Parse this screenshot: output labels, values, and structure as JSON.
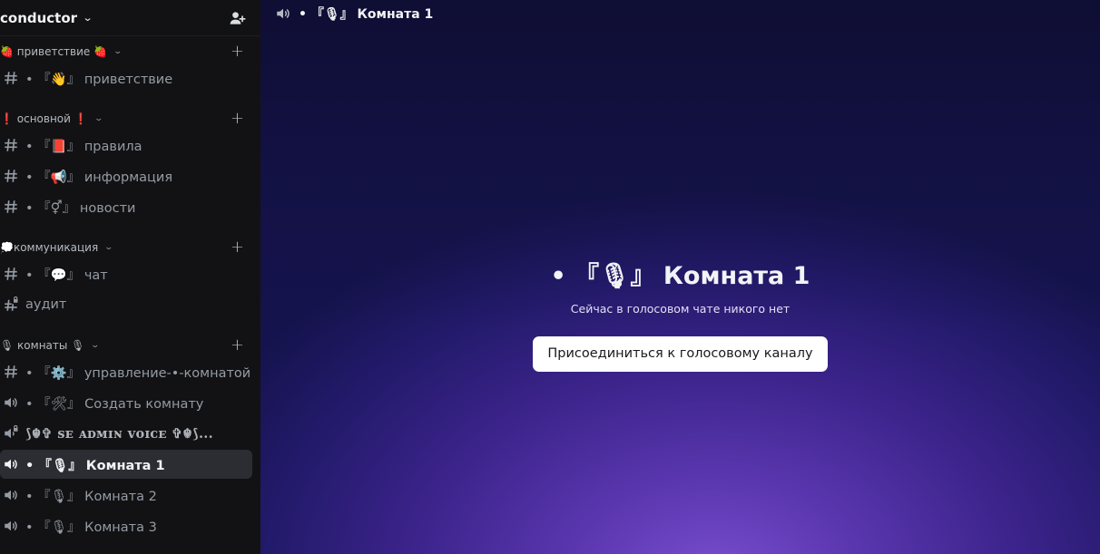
{
  "server": {
    "name": "conductor"
  },
  "categories": [
    {
      "label": "🍓 приветствие 🍓"
    },
    {
      "label": "❗ основной ❗"
    },
    {
      "label": "💭коммуникация"
    },
    {
      "label": "🎙 комнаты 🎙"
    }
  ],
  "channels": [
    {
      "type": "text",
      "name": "• 『👋』 приветствие"
    },
    {
      "type": "text",
      "name": "• 『📕』 правила"
    },
    {
      "type": "text",
      "name": "• 『📢』 информация"
    },
    {
      "type": "text",
      "name": "• 『⚥』 новости"
    },
    {
      "type": "text",
      "name": "• 『💬』 чат"
    },
    {
      "type": "text-locked",
      "name": "аудит"
    },
    {
      "type": "text",
      "name": "• 『⚙️』 управление-•-комнатой"
    },
    {
      "type": "voice",
      "name": "• 『🛠』 Создать комнату"
    },
    {
      "type": "voice-locked",
      "name": "⟆☬✞ ꜱᴇ ᴀᴅᴍɪɴ ᴠᴏɪᴄᴇ ✞☬⟆..."
    },
    {
      "type": "voice",
      "name": "• 『🎙』 Комната 1",
      "active": true
    },
    {
      "type": "voice",
      "name": "• 『🎙』 Комната 2"
    },
    {
      "type": "voice",
      "name": "• 『🎙』 Комната 3"
    }
  ],
  "main": {
    "topbar_title": "• 『🎙』 Комната 1",
    "room_title": "• 『🎙』 Комната 1",
    "empty_text": "Сейчас в голосовом чате никого нет",
    "join_button": "Присоединиться к голосовому каналу"
  },
  "colors": {
    "sidebar_bg": "#121214",
    "active_bg": "#2c2d32",
    "accent_purple": "#5b37b0"
  }
}
